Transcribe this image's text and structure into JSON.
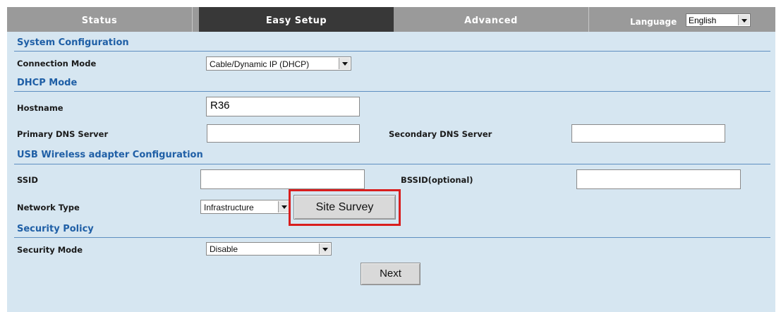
{
  "nav": {
    "tabs": [
      {
        "label": "Status",
        "active": false
      },
      {
        "label": "Easy Setup",
        "active": true
      },
      {
        "label": "Advanced",
        "active": false
      }
    ],
    "language_label": "Language",
    "language_value": "English"
  },
  "sections": {
    "system": {
      "title": "System Configuration",
      "connection_mode_label": "Connection Mode",
      "connection_mode_value": "Cable/Dynamic IP (DHCP)"
    },
    "dhcp": {
      "title": "DHCP Mode",
      "hostname_label": "Hostname",
      "hostname_value": "R36",
      "primary_dns_label": "Primary DNS Server",
      "primary_dns_value": "",
      "secondary_dns_label": "Secondary DNS Server",
      "secondary_dns_value": ""
    },
    "wireless": {
      "title": "USB Wireless adapter Configuration",
      "ssid_label": "SSID",
      "ssid_value": "",
      "bssid_label": "BSSID(optional)",
      "bssid_value": "",
      "network_type_label": "Network Type",
      "network_type_value": "Infrastructure",
      "site_survey_label": "Site Survey"
    },
    "security": {
      "title": "Security Policy",
      "security_mode_label": "Security Mode",
      "security_mode_value": "Disable"
    }
  },
  "next_label": "Next",
  "colors": {
    "nav_bg": "#9a9a9a",
    "nav_active": "#383838",
    "panel_bg": "#d6e6f1",
    "section_title": "#1f5fa6",
    "divider": "#5e8fc1",
    "highlight": "#d91e1e"
  },
  "icons": {
    "select_arrow": "chevron-down-icon"
  }
}
